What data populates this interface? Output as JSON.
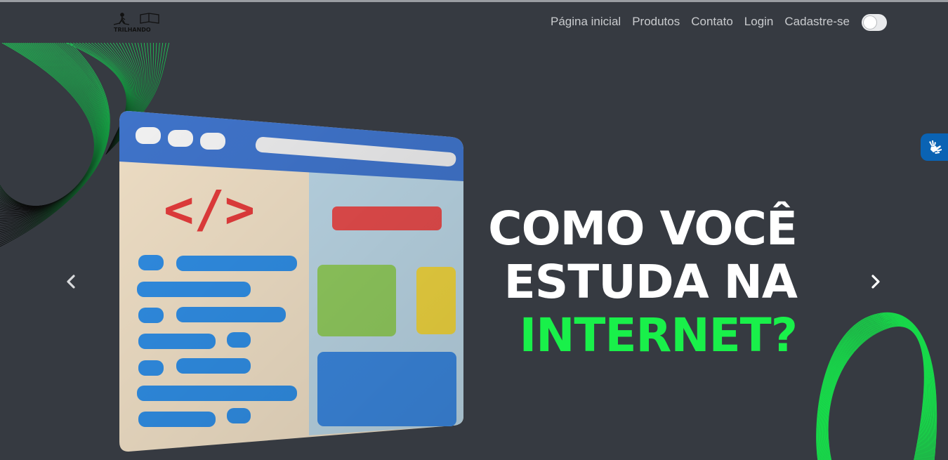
{
  "brand": {
    "logo_text": "TRILHANDO",
    "logo_icon": "hiker-book-icon"
  },
  "nav": {
    "items": [
      {
        "label": "Página inicial"
      },
      {
        "label": "Produtos"
      },
      {
        "label": "Contato"
      },
      {
        "label": "Login"
      },
      {
        "label": "Cadastre-se"
      }
    ],
    "theme_toggle": {
      "state": "off"
    }
  },
  "hero": {
    "line1": "COMO VOCÊ",
    "line2": "ESTUDA NA",
    "line3": "INTERNET?",
    "illustration": "browser-code-window-illustration",
    "illustration_code_glyph": "</>"
  },
  "carousel": {
    "prev_icon": "chevron-left-icon",
    "next_icon": "chevron-right-icon"
  },
  "accessibility": {
    "widget_icon": "sign-language-hands-icon"
  },
  "colors": {
    "background": "#363a41",
    "accent": "#19f04a",
    "nav_text": "#c9cbce",
    "vlibras": "#0a63b4"
  }
}
